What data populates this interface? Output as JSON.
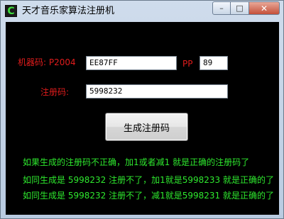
{
  "window": {
    "title": "天才音乐家算法注册机",
    "icon_letter": "C",
    "controls": {
      "minimize": "–",
      "maximize": "□",
      "close": "✕"
    }
  },
  "form": {
    "machine_code_label": "机器码: P2004",
    "machine_code_value": "EE87FF",
    "pp_label": "PP",
    "pp_value": "89",
    "reg_code_label": "注册码:",
    "reg_code_value": "5998232",
    "generate_button": "生成注册码"
  },
  "notes": [
    "如果生成的注册码不正确，加1或者减1 就是正确的注册码了",
    "如同生成是 5998232 注册不了，加1就是5998233 就是正确的了",
    "如同生成是 5998232 注册不了，减1就是5998231 就是正确的了"
  ],
  "colors": {
    "label_red": "#e01c1c",
    "note_green": "#2ee82e",
    "client_bg": "#000000"
  }
}
